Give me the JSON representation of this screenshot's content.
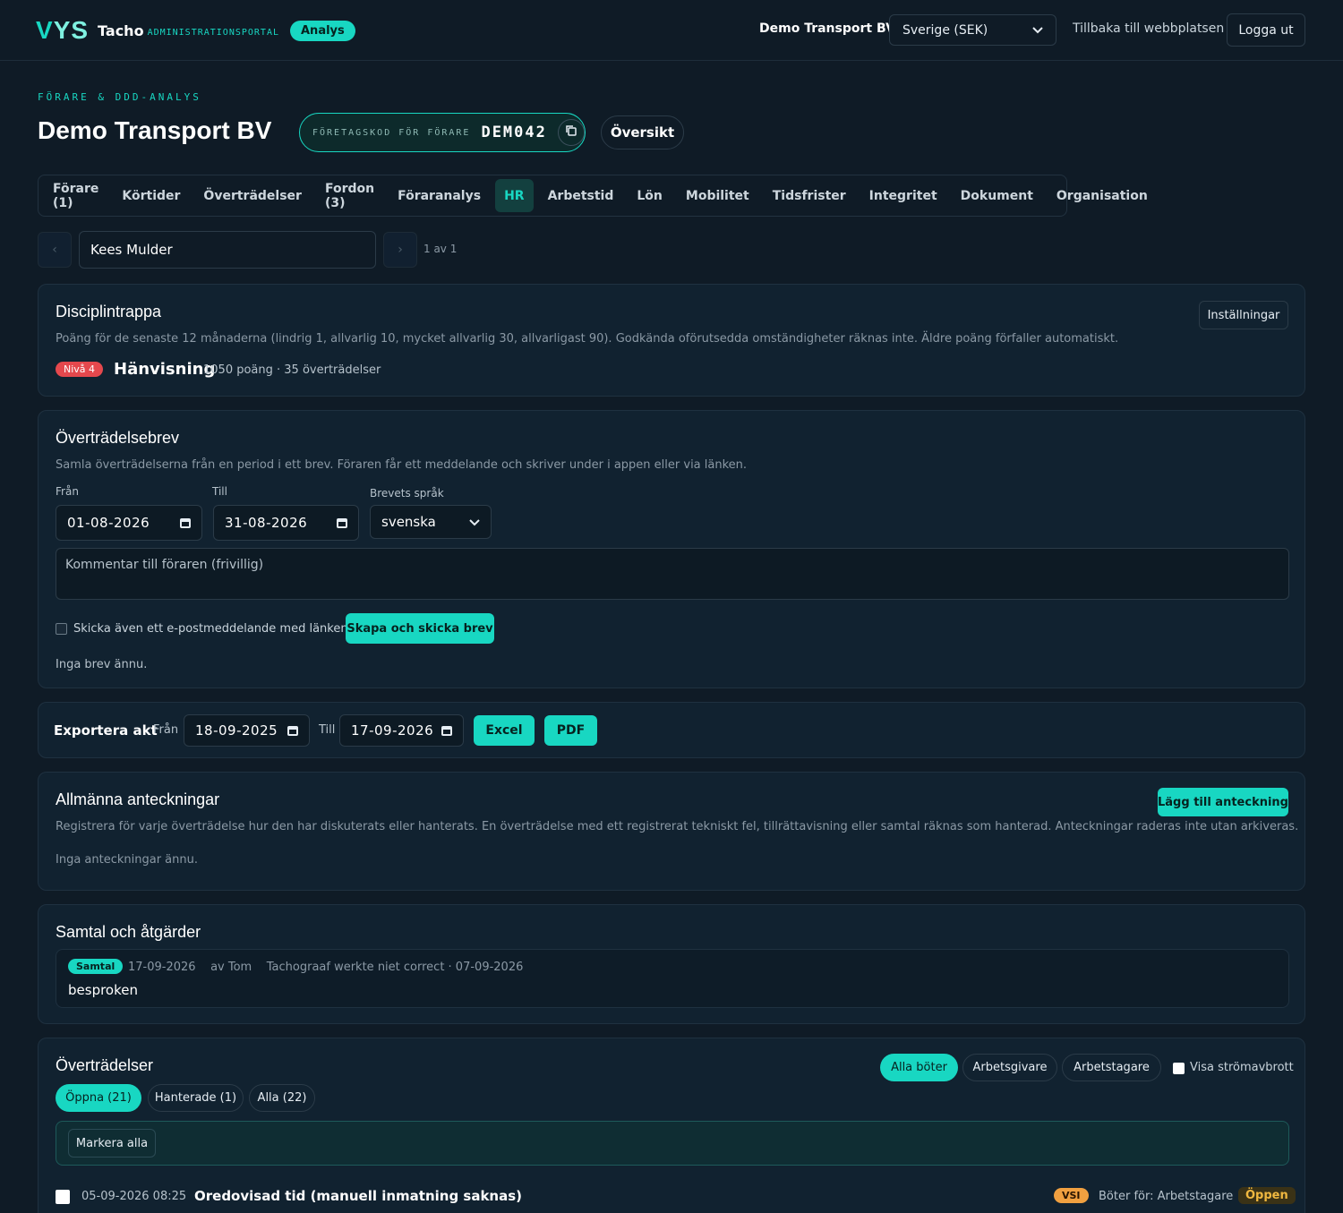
{
  "header": {
    "logo_mark_v": "V",
    "logo_mark_ys": "YS",
    "app_name": "Tacho",
    "app_sub": "ADMINISTRATIONSPORTAL",
    "mode_pill": "Analys",
    "company": "Demo Transport BV",
    "country_value": "Sverige (SEK)",
    "back_link": "Tillbaka till webbplatsen",
    "logout": "Logga ut"
  },
  "page": {
    "eyebrow": "FÖRARE & DDD-ANALYS",
    "title": "Demo Transport BV",
    "code_label": "FÖRETAGSKOD FÖR FÖRARE",
    "code_value": "DEM042",
    "overview": "Översikt"
  },
  "tabs": [
    {
      "label": "Förare (1)"
    },
    {
      "label": "Körtider"
    },
    {
      "label": "Överträdelser"
    },
    {
      "label": "Fordon (3)"
    },
    {
      "label": "Föraranalys"
    },
    {
      "label": "HR"
    },
    {
      "label": "Arbetstid"
    },
    {
      "label": "Lön"
    },
    {
      "label": "Mobilitet"
    },
    {
      "label": "Tidsfrister"
    },
    {
      "label": "Integritet"
    },
    {
      "label": "Dokument"
    },
    {
      "label": "Organisation"
    }
  ],
  "driver": {
    "prev": "‹",
    "next": "›",
    "name": "Kees Mulder",
    "pager": "1 av 1"
  },
  "discipline": {
    "title": "Disciplintrappa",
    "desc": "Poäng för de senaste 12 månaderna (lindrig 1, allvarlig 10, mycket allvarlig 30, allvarligast 90). Godkända oförutsedda omständigheter räknas inte. Äldre poäng förfaller automatiskt.",
    "settings": "Inställningar",
    "level_badge": "Nivå 4",
    "level_name": "Hänvisning",
    "level_meta": "1050 poäng · 35 överträdelser"
  },
  "letter": {
    "title": "Överträdelsebrev",
    "desc": "Samla överträdelserna från en period i ett brev. Föraren får ett meddelande och skriver under i appen eller via länken.",
    "from_label": "Från",
    "from_value": "01-08-2026",
    "to_label": "Till",
    "to_value": "31-08-2026",
    "lang_label": "Brevets språk",
    "lang_value": "svenska",
    "comment_placeholder": "Kommentar till föraren (frivillig)",
    "email_label": "Skicka även ett e-postmeddelande med länken",
    "create_btn": "Skapa och skicka brev",
    "empty": "Inga brev ännu."
  },
  "export": {
    "label": "Exportera akt",
    "from_label": "Från",
    "from_value": "18-09-2025",
    "to_label": "Till",
    "to_value": "17-09-2026",
    "excel": "Excel",
    "pdf": "PDF"
  },
  "notes": {
    "title": "Allmänna anteckningar",
    "add_btn": "Lägg till anteckning",
    "desc": "Registrera för varje överträdelse hur den har diskuterats eller hanterats. En överträdelse med ett registrerat tekniskt fel, tillrättavisning eller samtal räknas som hanterad. Anteckningar raderas inte utan arkiveras.",
    "empty": "Inga anteckningar ännu."
  },
  "conversations": {
    "title": "Samtal och åtgärder",
    "items": [
      {
        "badge": "Samtal",
        "meta": "17-09-2026    av Tom    Tachograaf werkte niet correct · 07-09-2026",
        "text": "besproken"
      }
    ]
  },
  "violations": {
    "title": "Överträdelser",
    "fine_filters": [
      "Alla böter",
      "Arbetsgivare",
      "Arbetstagare"
    ],
    "power_label": "Visa strömavbrott",
    "status_filters": [
      "Öppna (21)",
      "Hanterade (1)",
      "Alla (22)"
    ],
    "mark_all": "Markera alla",
    "rows": [
      {
        "datetime": "05-09-2026 08:25",
        "title": "Oredovisad tid (manuell inmatning saknas)",
        "badge": "VSI",
        "fine": "Böter för: Arbetstagare",
        "status": "Öppen"
      }
    ]
  }
}
